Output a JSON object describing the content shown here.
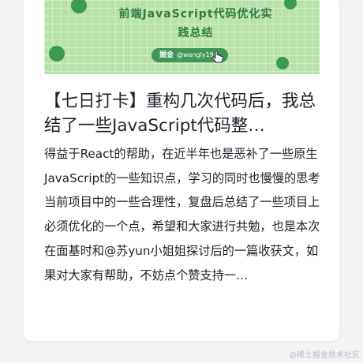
{
  "cover": {
    "title": "前端JavaScript代码优化实践总结",
    "author_label": "掘金",
    "author_handle": "@wangly19"
  },
  "article": {
    "title": "【七日打卡】重构几次代码后，我总结了一些JavaScript代码整…",
    "excerpt": "得益于React的帮助，在近半年也是恶补了一些原生JavaScript的一些知识点，学习的同时也慢慢的思考当前项目中的一些合理性，复盘后总结了一些项目上必须优化的一个点，希望和大家进行共勉，也是本次在面基时和@苏yun小姐姐探讨后的一篇收获文，如果对大家有帮助，不妨点个赞支持一…"
  },
  "watermark": "@稀土掘金技术社区",
  "colors": {
    "cover_bg": "#b9e2a9",
    "accent_green": "#3c9a55",
    "text": "#1d2129"
  }
}
